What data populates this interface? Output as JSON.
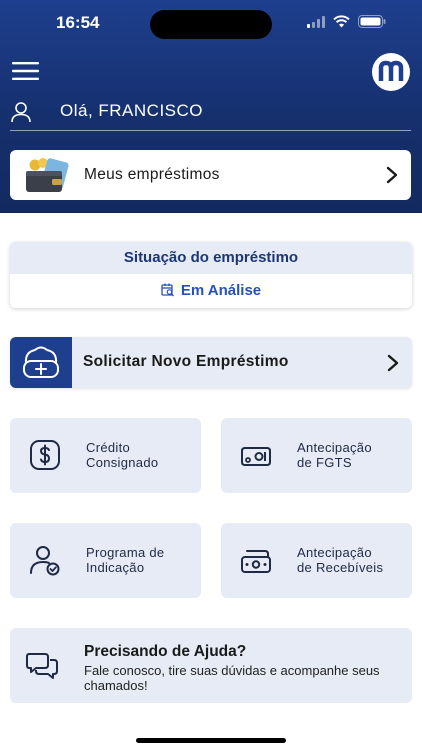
{
  "status_bar": {
    "time": "16:54"
  },
  "header": {
    "menu_icon": "hamburger-menu-icon",
    "logo_icon": "brand-logo-icon",
    "greeting": "Olá, FRANCISCO",
    "user_icon": "user-icon"
  },
  "loans": {
    "label": "Meus empréstimos",
    "icon": "wallet-icon"
  },
  "loan_status": {
    "title": "Situação do empréstimo",
    "value": "Em Análise",
    "icon": "calendar-search-icon"
  },
  "request_loan": {
    "label": "Solicitar Novo Empréstimo",
    "icon": "cloud-add-icon"
  },
  "tiles": [
    {
      "label_line1": "Crédito",
      "label_line2": "Consignado",
      "icon": "dollar-icon"
    },
    {
      "label_line1": "Antecipação",
      "label_line2": "de FGTS",
      "icon": "cash-icon"
    },
    {
      "label_line1": "Programa de",
      "label_line2": "Indicação",
      "icon": "user-check-icon"
    },
    {
      "label_line1": "Antecipação",
      "label_line2": "de Recebíveis",
      "icon": "money-transfer-icon"
    }
  ],
  "help": {
    "title": "Precisando de Ajuda?",
    "subtitle": "Fale conosco, tire suas dúvidas e acompanhe seus chamados!",
    "icon": "chat-icon"
  },
  "colors": {
    "header": "#1e3f8e",
    "card_bg": "#e6ebf5",
    "accent": "#2750b8",
    "title_blue": "#1c3777"
  }
}
